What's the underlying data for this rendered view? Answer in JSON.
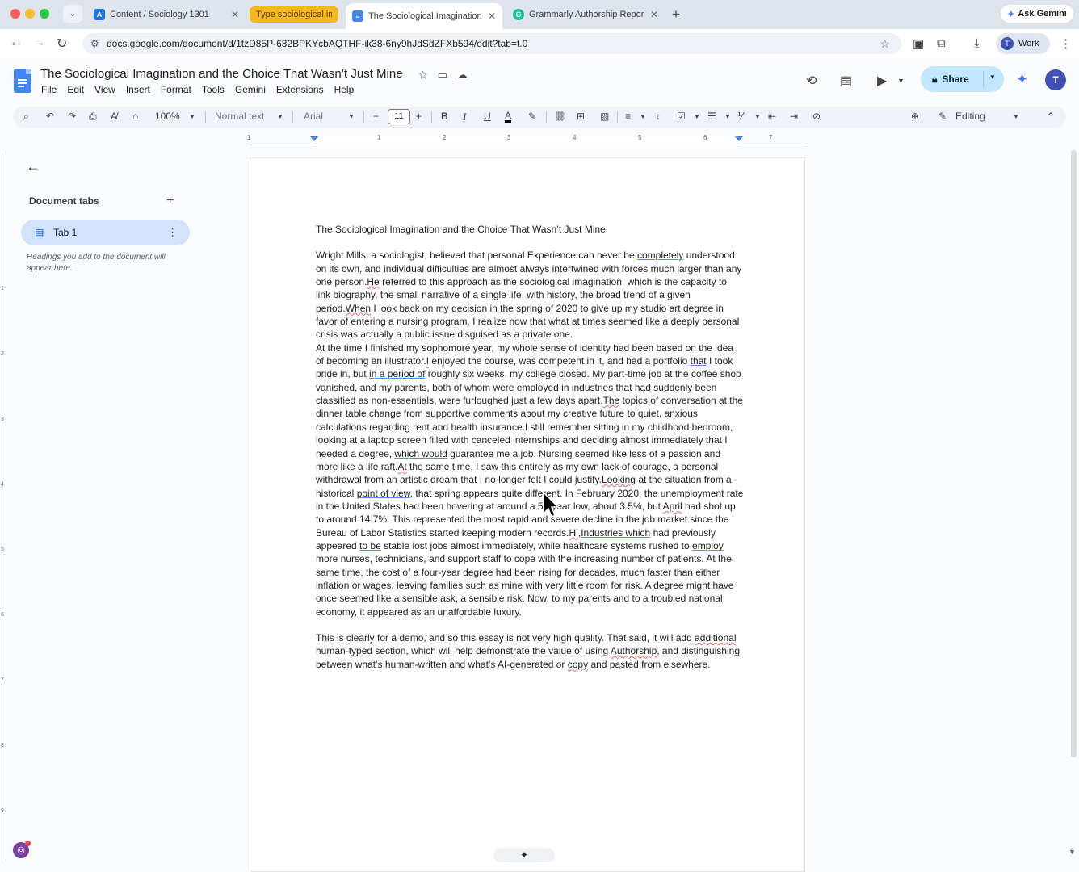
{
  "browser": {
    "tabs": [
      {
        "title": "Content / Sociology 1301",
        "favicon_color": "#1a73e8"
      },
      {
        "title": "Type sociological im",
        "favicon_color": "#f3b81c"
      },
      {
        "title": "The Sociological Imagination",
        "favicon_color": "#4285f4"
      },
      {
        "title": "Grammarly Authorship Repor",
        "favicon_color": "#15c39a"
      }
    ],
    "ask_gemini": "Ask Gemini",
    "url": "docs.google.com/document/d/1tzD85P-632BPKYcbAQTHF-ik38-6ny9hJdSdZFXb594/edit?tab=t.0",
    "profile_label": "Work",
    "profile_initial": "T"
  },
  "docs": {
    "title": "The Sociological Imagination and the Choice That Wasn’t Just Mine",
    "menu": [
      "File",
      "Edit",
      "View",
      "Insert",
      "Format",
      "Tools",
      "Gemini",
      "Extensions",
      "Help"
    ],
    "share_label": "Share",
    "account_initial": "T",
    "toolbar": {
      "zoom": "100%",
      "style": "Normal text",
      "font": "Arial",
      "font_size": "11",
      "mode": "Editing"
    },
    "ruler_numbers": [
      "1",
      "1",
      "2",
      "3",
      "4",
      "5",
      "6",
      "7"
    ],
    "vruler_numbers": [
      "1",
      "2",
      "3",
      "4",
      "5",
      "6",
      "7",
      "8",
      "9"
    ]
  },
  "sidebar": {
    "heading": "Document tabs",
    "tab_label": "Tab 1",
    "hint": "Headings you add to the document will appear here."
  },
  "document": {
    "heading": "The Sociological Imagination and the Choice That Wasn’t Just Mine"
  },
  "colors": {
    "accent": "#0b57d0",
    "share_bg": "#c2e7ff",
    "spelling_underline": "#e06b6b",
    "grammar_underline": "#4b8df8"
  }
}
